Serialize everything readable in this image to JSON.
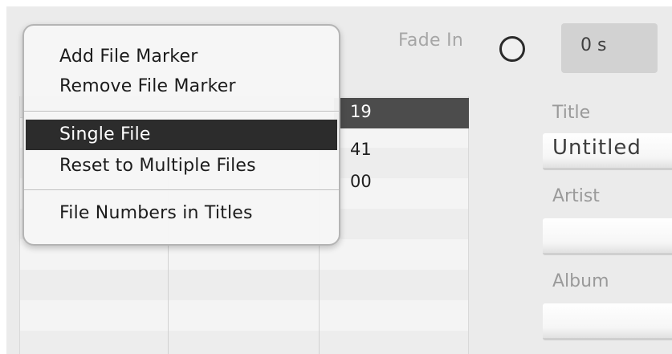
{
  "fade_in": {
    "label": "Fade In",
    "value": "0 s"
  },
  "table": {
    "visible_cells": [
      "19",
      "41",
      "00"
    ],
    "selected_row": 0
  },
  "metadata": {
    "title_label": "Title",
    "title_value": "Untitled",
    "artist_label": "Artist",
    "artist_value": "",
    "album_label": "Album",
    "album_value": ""
  },
  "context_menu": {
    "items": [
      {
        "label": "Add File Marker",
        "highlighted": false
      },
      {
        "label": "Remove File Marker",
        "highlighted": false
      },
      {
        "label": "Single File",
        "highlighted": true
      },
      {
        "label": "Reset to Multiple Files",
        "highlighted": false
      },
      {
        "label": "File Numbers in Titles",
        "highlighted": false
      }
    ]
  },
  "colors": {
    "panel_bg": "#ebebeb",
    "menu_highlight": "#2c2c2c",
    "selected_cell": "#4c4c4c",
    "label_gray": "#a6a6a6"
  }
}
